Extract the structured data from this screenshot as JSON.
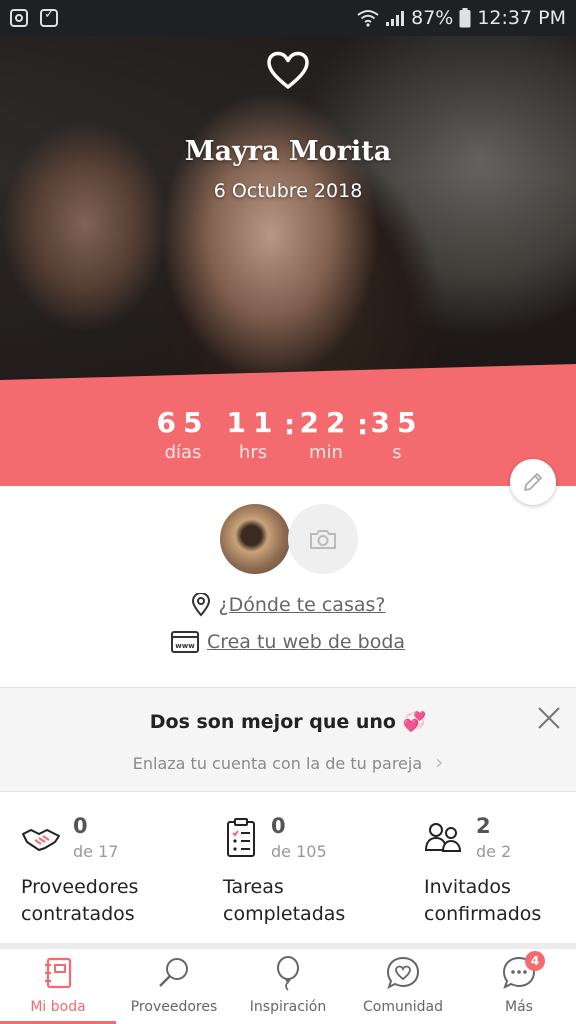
{
  "status_bar": {
    "battery": "87%",
    "time": "12:37 PM"
  },
  "hero": {
    "couple_name": "Mayra Morita",
    "date": "6 Octubre 2018"
  },
  "countdown": {
    "days": "65",
    "days_label": "días",
    "hours": "11",
    "hours_label": "hrs",
    "minutes": "22",
    "minutes_label": "min",
    "seconds": "35",
    "seconds_label": "s",
    "separator": ":"
  },
  "profile": {
    "where_label": "¿Dónde te casas?",
    "web_label": "Crea tu web de boda"
  },
  "partner_banner": {
    "title": "Dos son mejor que uno 💞",
    "subtitle": "Enlaza tu cuenta con la de tu pareja",
    "chevron": "›"
  },
  "stats": [
    {
      "count": "0",
      "total": "de 17",
      "label_line1": "Proveedores",
      "label_line2": "contratados",
      "icon": "handshake-icon"
    },
    {
      "count": "0",
      "total": "de 105",
      "label_line1": "Tareas",
      "label_line2": "completadas",
      "icon": "checklist-icon"
    },
    {
      "count": "2",
      "total": "de 2",
      "label_line1": "Invitados",
      "label_line2": "confirmados",
      "icon": "guests-icon"
    }
  ],
  "nav": [
    {
      "label": "Mi boda",
      "icon": "notebook-icon",
      "active": true
    },
    {
      "label": "Proveedores",
      "icon": "magnifier-icon"
    },
    {
      "label": "Inspiración",
      "icon": "balloon-icon"
    },
    {
      "label": "Comunidad",
      "icon": "chat-heart-icon"
    },
    {
      "label": "Más",
      "icon": "more-icon",
      "badge": "4"
    }
  ],
  "colors": {
    "accent": "#f46b6f",
    "status_bar": "#1f2021"
  }
}
